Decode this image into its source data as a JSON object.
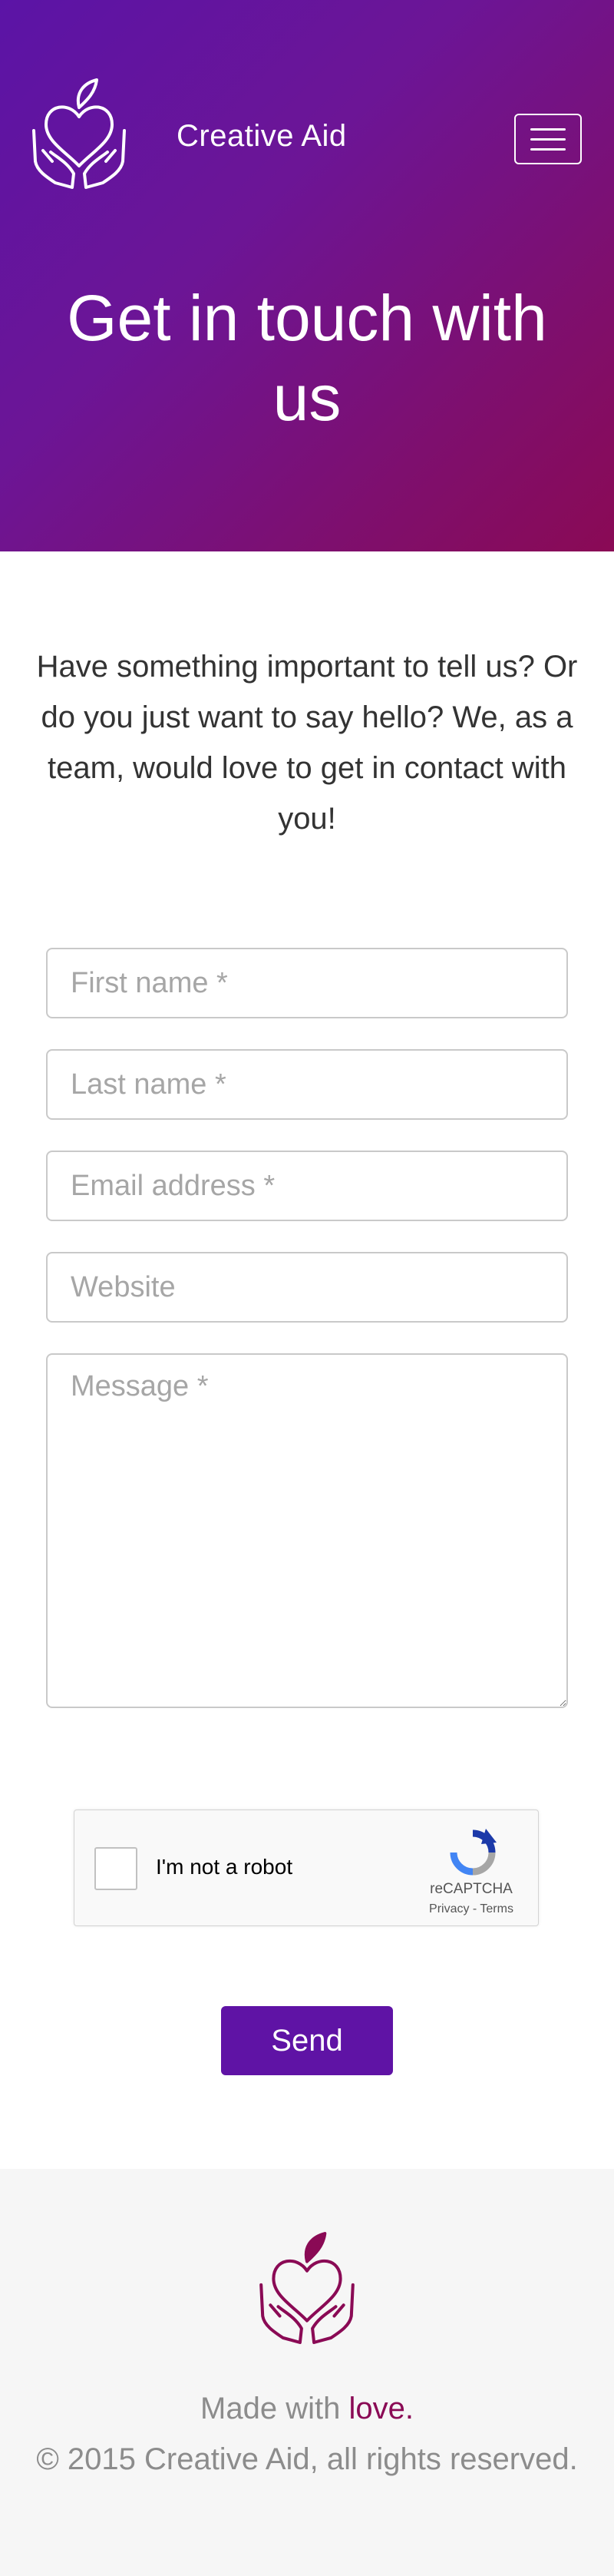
{
  "header": {
    "brand": "Creative Aid",
    "logo_icon": "heart-hands-icon",
    "menu_icon": "hamburger-menu-icon",
    "title": "Get in touch with us",
    "gradient_colors": [
      "#5b14a6",
      "#8a0a55"
    ]
  },
  "intro": {
    "text": "Have something important to tell us? Or do you just want to say hello? We, as a team, would love to get in contact with you!"
  },
  "form": {
    "first_name_placeholder": "First name *",
    "last_name_placeholder": "Last name *",
    "email_placeholder": "Email address *",
    "website_placeholder": "Website",
    "message_placeholder": "Message *",
    "send_label": "Send",
    "send_color": "#5f13a5"
  },
  "captcha": {
    "label": "I'm not a robot",
    "brand": "reCAPTCHA",
    "privacy": "Privacy",
    "separator": " - ",
    "terms": "Terms",
    "icon": "recaptcha-icon"
  },
  "footer": {
    "made_with": "Made with ",
    "love": "love.",
    "copyright": "© 2015 Creative Aid, all rights reserved.",
    "logo_icon": "heart-hands-icon",
    "accent_color": "#8a0a55"
  }
}
